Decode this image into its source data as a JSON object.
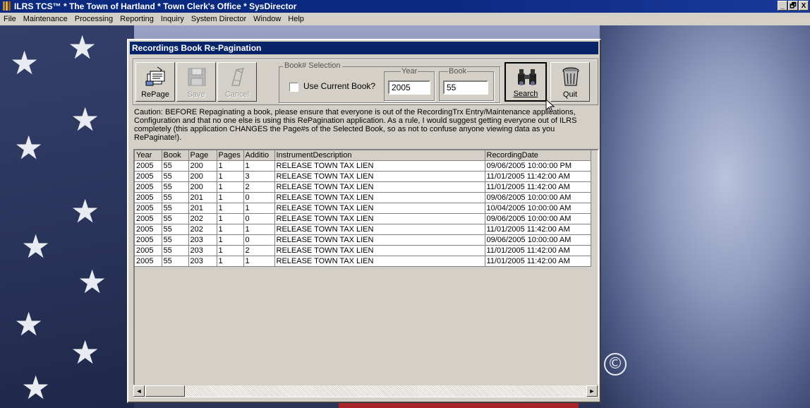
{
  "window": {
    "title": "ILRS TCS™ * The Town of Hartland * Town Clerk's Office * SysDirector",
    "buttons": [
      "_",
      "🗗",
      "X"
    ]
  },
  "menu": [
    "File",
    "Maintenance",
    "Processing",
    "Reporting",
    "Inquiry",
    "System Director",
    "Window",
    "Help"
  ],
  "dialog": {
    "title": "Recordings Book Re-Pagination",
    "toolbar": {
      "repage_label": "RePage",
      "save_label": "Save",
      "cancel_label": "Cancel",
      "search_label": "Search",
      "quit_label": "Quit"
    },
    "book_selection": {
      "group_label": "Book# Selection",
      "use_current_label": "Use Current Book?",
      "use_current_checked": false,
      "year_label": "Year",
      "year_value": "2005",
      "book_label": "Book",
      "book_value": "55"
    },
    "caution": "Caution: BEFORE Repaginating a book, please ensure that everyone is out of the RecordingTrx Entry/Maintenance applications, Configuration and that no one else is using this RePagination application. As a rule, I would suggest getting everyone out of ILRS completely (this application CHANGES the Page#s of the Selected Book, so as not to confuse anyone viewing data as you RePaginate!).",
    "grid": {
      "columns": [
        "Year",
        "Book",
        "Page",
        "Pages",
        "Additio",
        "InstrumentDescription",
        "RecordingDate"
      ],
      "rows": [
        [
          "2005",
          "55",
          "200",
          "1",
          "1",
          "RELEASE TOWN TAX LIEN",
          "09/06/2005 10:00:00 PM"
        ],
        [
          "2005",
          "55",
          "200",
          "1",
          "3",
          "RELEASE TOWN TAX LIEN",
          "11/01/2005 11:42:00 AM"
        ],
        [
          "2005",
          "55",
          "200",
          "1",
          "2",
          "RELEASE TOWN TAX LIEN",
          "11/01/2005 11:42:00 AM"
        ],
        [
          "2005",
          "55",
          "201",
          "1",
          "0",
          "RELEASE TOWN TAX LIEN",
          "09/06/2005 10:00:00 AM"
        ],
        [
          "2005",
          "55",
          "201",
          "1",
          "1",
          "RELEASE TOWN TAX LIEN",
          "10/04/2005 10:00:00 AM"
        ],
        [
          "2005",
          "55",
          "202",
          "1",
          "0",
          "RELEASE TOWN TAX LIEN",
          "09/06/2005 10:00:00 AM"
        ],
        [
          "2005",
          "55",
          "202",
          "1",
          "1",
          "RELEASE TOWN TAX LIEN",
          "11/01/2005 11:42:00 AM"
        ],
        [
          "2005",
          "55",
          "203",
          "1",
          "0",
          "RELEASE TOWN TAX LIEN",
          "09/06/2005 10:00:00 AM"
        ],
        [
          "2005",
          "55",
          "203",
          "1",
          "2",
          "RELEASE TOWN TAX LIEN",
          "11/01/2005 11:42:00 AM"
        ],
        [
          "2005",
          "55",
          "203",
          "1",
          "1",
          "RELEASE TOWN TAX LIEN",
          "11/01/2005 11:42:00 AM"
        ]
      ]
    },
    "scrollbar": {
      "left_arrow": "◄",
      "right_arrow": "►"
    }
  },
  "desktop": {
    "copyright_mark": "©"
  },
  "icons": [
    "app-icon",
    "repage-icon",
    "save-icon",
    "cancel-icon",
    "binoculars-icon",
    "trash-icon",
    "star-icon",
    "mouse-cursor-icon"
  ],
  "colors": {
    "title_bar": "#0a246a",
    "window_face": "#d4d0c8",
    "flag_red": "#a8242a"
  }
}
